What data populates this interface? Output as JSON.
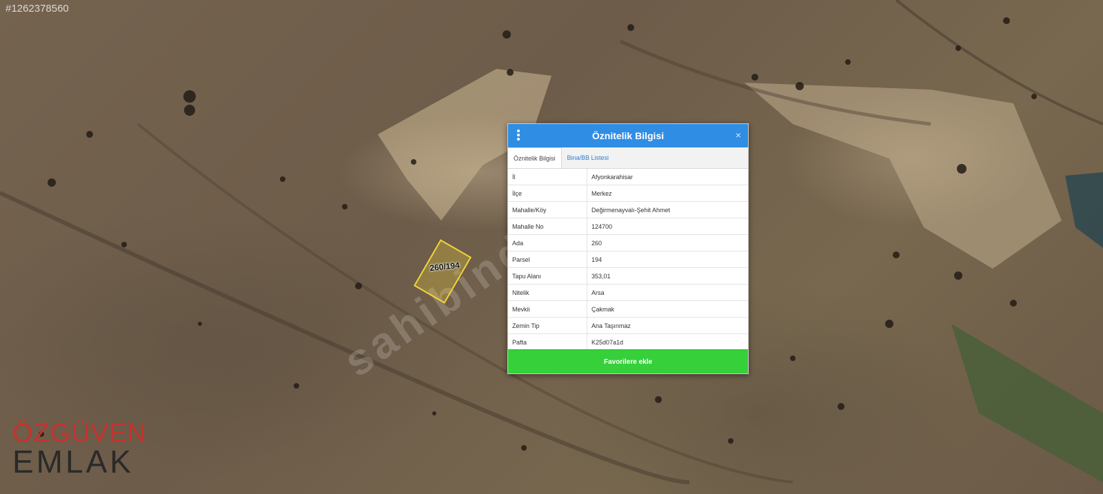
{
  "watermark_id": "#1262378560",
  "logo": {
    "top": "ÖZGÜVEN",
    "bottom": "EMLAK"
  },
  "diagonal_watermark": "sahibinden",
  "parcel": {
    "label": "260/194",
    "color": "#f0d43a"
  },
  "panel": {
    "title": "Öznitelik Bilgisi",
    "menu_icon": "vertical-dots-icon",
    "close_icon": "close-icon",
    "close_glyph": "×",
    "tabs": [
      {
        "label": "Öznitelik Bilgisi",
        "active": true
      },
      {
        "label": "Bina/BB Listesi",
        "active": false
      }
    ],
    "rows": [
      {
        "key": "İl",
        "value": "Afyonkarahisar"
      },
      {
        "key": "İlçe",
        "value": "Merkez"
      },
      {
        "key": "Mahalle/Köy",
        "value": "Değirmenayvalı-Şehit Ahmet"
      },
      {
        "key": "Mahalle No",
        "value": "124700"
      },
      {
        "key": "Ada",
        "value": "260"
      },
      {
        "key": "Parsel",
        "value": "194"
      },
      {
        "key": "Tapu Alanı",
        "value": "353,01"
      },
      {
        "key": "Nitelik",
        "value": "Arsa"
      },
      {
        "key": "Mevkii",
        "value": "Çakmak"
      },
      {
        "key": "Zemin Tip",
        "value": "Ana Taşınmaz"
      },
      {
        "key": "Pafta",
        "value": "K25d07a1d"
      }
    ],
    "favorite_button": "Favorilere ekle",
    "header_color": "#2f8de4",
    "button_color": "#35d03a"
  }
}
